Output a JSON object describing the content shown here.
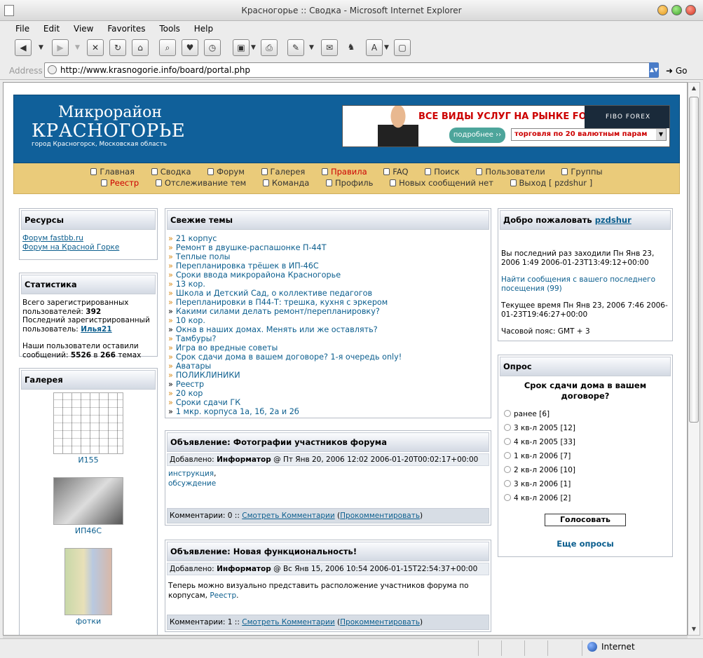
{
  "window": {
    "title": "Красногорье :: Сводка - Microsoft Internet Explorer"
  },
  "menu": [
    "File",
    "Edit",
    "View",
    "Favorites",
    "Tools",
    "Help"
  ],
  "address": {
    "label": "Address",
    "url": "http://www.krasnogorie.info/board/portal.php",
    "go": "Go"
  },
  "status": {
    "zone": "Internet"
  },
  "header": {
    "logo_line1": "Микрорайон",
    "logo_line2": "КРАСНОГОРЬЕ",
    "logo_line3": "город Красногорск, Московская область",
    "banner": {
      "headline": "ВСЕ ВИДЫ УСЛУГ НА РЫНКЕ FOREX",
      "brand": "FIBO FOREX",
      "more": "подробнее ››",
      "select": "торговля по 20 валютным парам"
    }
  },
  "nav": {
    "row1": [
      "Главная",
      "Сводка",
      "Форум",
      "Галерея",
      "Правила",
      "FAQ",
      "Поиск",
      "Пользователи",
      "Группы"
    ],
    "row2": [
      "Реестр",
      "Отслеживание тем",
      "Команда",
      "Профиль",
      "Новых сообщений нет",
      "Выход [ pzdshur ]"
    ],
    "highlight": "#cc0000"
  },
  "resources": {
    "title": "Ресурсы",
    "links": [
      "Форум fastbb.ru",
      "Форум на Красной Горке"
    ]
  },
  "stats": {
    "title": "Статистика",
    "reg_label": "Всего зарегистрированных пользователей:",
    "reg_count": "392",
    "last_label": "Последний зарегистрированный пользователь:",
    "last_user": "Илья21",
    "msg_label": "Наши пользователи оставили сообщений:",
    "msg_count": "5526",
    "in": "в",
    "topics_count": "266",
    "topics_label": "темах"
  },
  "gallery": {
    "title": "Галерея",
    "items": [
      "И155",
      "ИП46С",
      "фотки"
    ]
  },
  "fresh": {
    "title": "Свежие темы",
    "topics": [
      "21 корпус",
      "Ремонт в двушке-распашонке П-44Т",
      "Теплые полы",
      "Перепланировка трёшек в ИП-46С",
      "Сроки ввода микрорайона Красногорье",
      "13 кор.",
      "Школа и Детский Сад, о коллективе педагогов",
      "Перепланировки в П44-Т: трешка, кухня с эркером",
      "Какими силами делать ремонт/перепланировку?",
      "10 кор.",
      "Окна в наших домах. Менять или же оставлять?",
      "Тамбуры?",
      "Игра во вредные советы",
      "Срок сдачи дома в вашем договоре? 1-я очередь only!",
      "Аватары",
      "ПОЛИКЛИНИКИ",
      "Реестр",
      "20 кор",
      "Сроки сдачи ГК",
      "1 мкр. корпуса 1а, 1б, 2а и 2б"
    ],
    "bold_marker_index": [
      8,
      10,
      16,
      19
    ]
  },
  "ann1": {
    "title": "Объявление: Фотографии участников форума",
    "added": "Добавлено:",
    "author": "Информатор",
    "date": "@ Пт Янв 20, 2006 12:02 2006-01-20T00:02:17+00:00",
    "link1": "инструкция",
    "link2": "обсуждение",
    "comments_label": "Комментарии: 0 ::",
    "view": "Смотреть Комментарии",
    "post": "Прокомментировать"
  },
  "ann2": {
    "title": "Объявление: Новая функциональность!",
    "added": "Добавлено:",
    "author": "Информатор",
    "date": "@ Вс Янв 15, 2006 10:54 2006-01-15T22:54:37+00:00",
    "body": "Теперь можно визуально представить расположение участников форума по корпусам,",
    "body_link": "Реестр",
    "comments_label": "Комментарии: 1 ::",
    "view": "Смотреть Комментарии",
    "post": "Прокомментировать"
  },
  "welcome": {
    "title": "Добро пожаловать",
    "user": "pzdshur",
    "last_visit": "Вы последний раз заходили Пн Янв 23, 2006 1:49 2006-01-23T13:49:12+00:00",
    "find": "Найти сообщения с вашего последнего посещения (99)",
    "now": "Текущее время Пн Янв 23, 2006 7:46 2006-01-23T19:46:27+00:00",
    "tz": "Часовой пояс: GMT + 3"
  },
  "poll": {
    "title": "Опрос",
    "question": "Срок сдачи дома в вашем договоре?",
    "options": [
      "ранее [6]",
      "3 кв-л 2005 [12]",
      "4 кв-л 2005 [33]",
      "1 кв-л 2006 [7]",
      "2 кв-л 2006 [10]",
      "3 кв-л 2006 [1]",
      "4 кв-л 2006 [2]"
    ],
    "vote": "Голосовать",
    "more": "Еще опросы"
  }
}
